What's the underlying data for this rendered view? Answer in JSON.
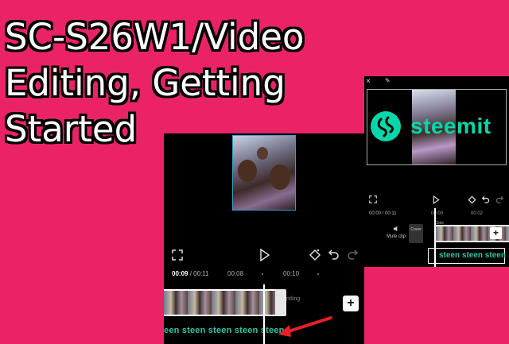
{
  "title": {
    "line1": "SC-S26W1/Video",
    "line2": "Editing, Getting",
    "line3": "Started"
  },
  "colors": {
    "background": "#ea2367",
    "steemit_green": "#06d6a9",
    "text_track_green": "#2fc5a6"
  },
  "editor_left": {
    "time_current": "00:09",
    "time_total": "00:11",
    "ticks": [
      "00:08",
      "00:10"
    ],
    "ending_label": "nding",
    "text_track": "een steen steen steen steen",
    "add_icon": "+"
  },
  "editor_right": {
    "logo_text": "steemit",
    "time": "00:00 / 00:11",
    "ticks": [
      "00:00",
      "00:02"
    ],
    "mute_label": "Mute clip",
    "cover_label": "Cover",
    "side_label": "Side",
    "text_track": "steen steen steen",
    "add_icon": "+"
  }
}
